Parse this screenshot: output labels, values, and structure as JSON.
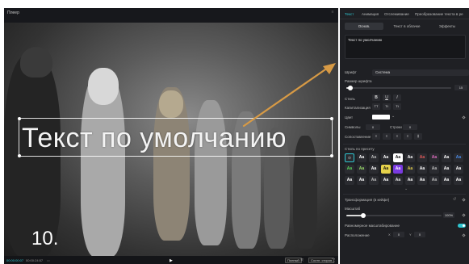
{
  "player": {
    "title": "Плеер",
    "overlay_text": "Текст по умолчанию",
    "step_number": "10.",
    "time_current": "00:00:00:07",
    "time_total": "00:00:24:57",
    "btn_full": "Полный",
    "btn_ratio": "Соотн. сторон"
  },
  "panel": {
    "tabs": [
      "Текст",
      "Анимация",
      "Отслеживание",
      "Преобразование текста в ре"
    ],
    "subtabs": [
      "Основ.",
      "Текст в облачке",
      "Эффекты"
    ],
    "textarea_value": "Текст по умолчанию",
    "font_label": "Шрифт",
    "font_value": "Система",
    "size_label": "Размер шрифта",
    "size_value": "15",
    "style_label": "Стиль",
    "style_buttons": [
      "B",
      "U",
      "I"
    ],
    "caps_label": "Капитализация",
    "caps_buttons": [
      "TT",
      "Tt",
      "Tt"
    ],
    "color_label": "Цвет",
    "symbols_label": "Символы",
    "symbols_value": "0",
    "lines_label": "Строки",
    "lines_value": "0",
    "align_label": "Сопоставление",
    "presets_label": "Стиль по пресету",
    "preset_glyph": "Aa",
    "transform_label": "Трансформация (в кейфе)",
    "scale_label": "Масштаб",
    "scale_value": "100%",
    "uniform_label": "Равномерное масштабирование",
    "position_label": "Расположение",
    "pos_x": "0",
    "pos_y": "0"
  },
  "colors": {
    "accent": "#2fc5d0",
    "arrow": "#d79a45",
    "panel_bg": "#1f2024"
  }
}
